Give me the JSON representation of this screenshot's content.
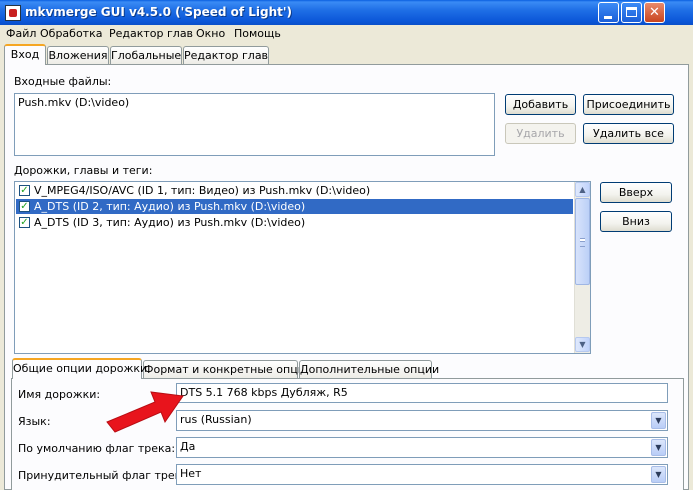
{
  "window": {
    "title": "mkvmerge GUI v4.5.0 ('Speed of Light')",
    "icon": "app-icon",
    "controls": {
      "minimize": "minimize-icon",
      "maximize": "maximize-icon",
      "close": "✕"
    }
  },
  "menu": [
    "Файл",
    "Обработка",
    "Редактор глав",
    "Окно",
    "Помощь"
  ],
  "tabs": [
    "Вход",
    "Вложения",
    "Глобальные",
    "Редактор глав"
  ],
  "input_files": {
    "label": "Входные файлы:",
    "files": [
      "Push.mkv (D:\\video)"
    ],
    "buttons": {
      "add": "Добавить",
      "append": "Присоединить",
      "remove": "Удалить",
      "remove_all": "Удалить все"
    }
  },
  "tracks": {
    "label": "Дорожки, главы и теги:",
    "items": [
      {
        "text": "V_MPEG4/ISO/AVC (ID 1, тип: Видео) из Push.mkv (D:\\video)",
        "checked": true
      },
      {
        "text": "A_DTS (ID 2, тип: Аудио) из Push.mkv (D:\\video)",
        "checked": true
      },
      {
        "text": "A_DTS (ID 3, тип: Аудио) из Push.mkv (D:\\video)",
        "checked": true
      }
    ],
    "buttons": {
      "up": "Вверх",
      "down": "Вниз"
    }
  },
  "subtabs": [
    "Общие опции дорожки",
    "Формат и конкретные опции",
    "Дополнительные опции"
  ],
  "options": {
    "track_name": {
      "label": "Имя дорожки:",
      "value": "DTS 5.1 768 kbps Дубляж, R5"
    },
    "language": {
      "label": "Язык:",
      "value": "rus (Russian)"
    },
    "default_flag": {
      "label": "По умолчанию флаг трека:",
      "value": "Да"
    },
    "forced_flag": {
      "label": "Принудительный флаг трека:",
      "value": "Нет"
    }
  },
  "colors": {
    "selection": "#316ac5",
    "annotation_arrow": "#e8141c",
    "titlebar": "#0b56d8"
  }
}
